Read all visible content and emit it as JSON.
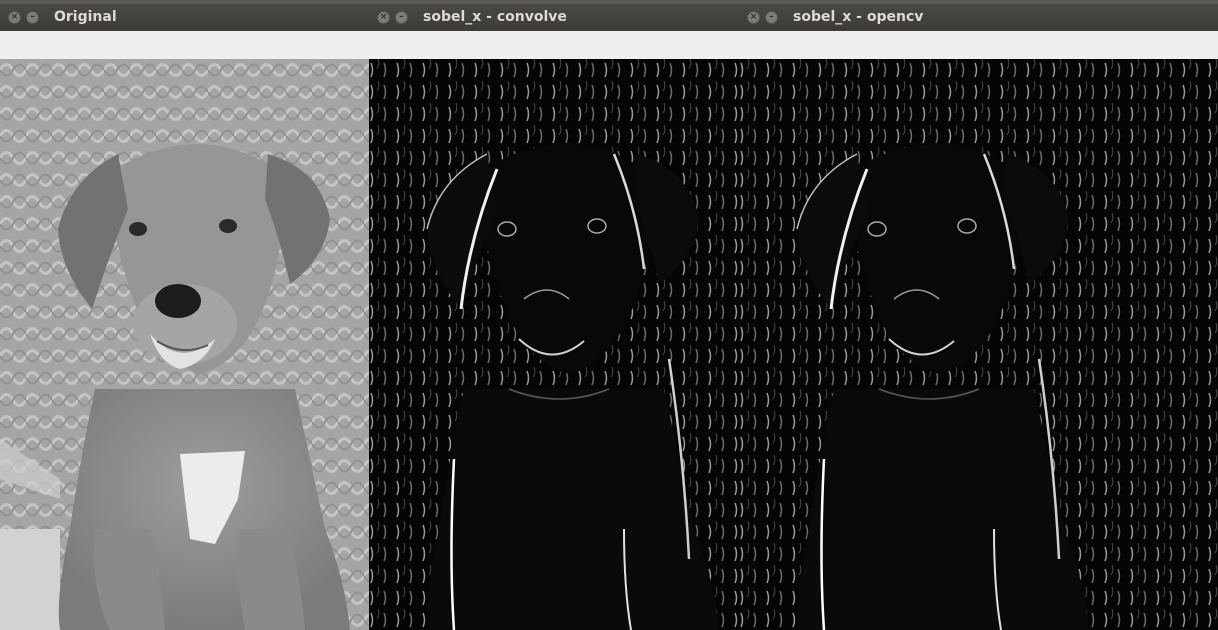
{
  "windows": [
    {
      "title": "Original",
      "close_icon": "close-icon",
      "minimize_icon": "minimize-icon"
    },
    {
      "title": "sobel_x - convolve",
      "close_icon": "close-icon",
      "minimize_icon": "minimize-icon"
    },
    {
      "title": "sobel_x - opencv",
      "close_icon": "close-icon",
      "minimize_icon": "minimize-icon"
    }
  ],
  "colors": {
    "titlebar": "#3c3b37",
    "title_text": "#dfdbd2",
    "toolbar": "#efefef",
    "edge_background": "#050505"
  }
}
